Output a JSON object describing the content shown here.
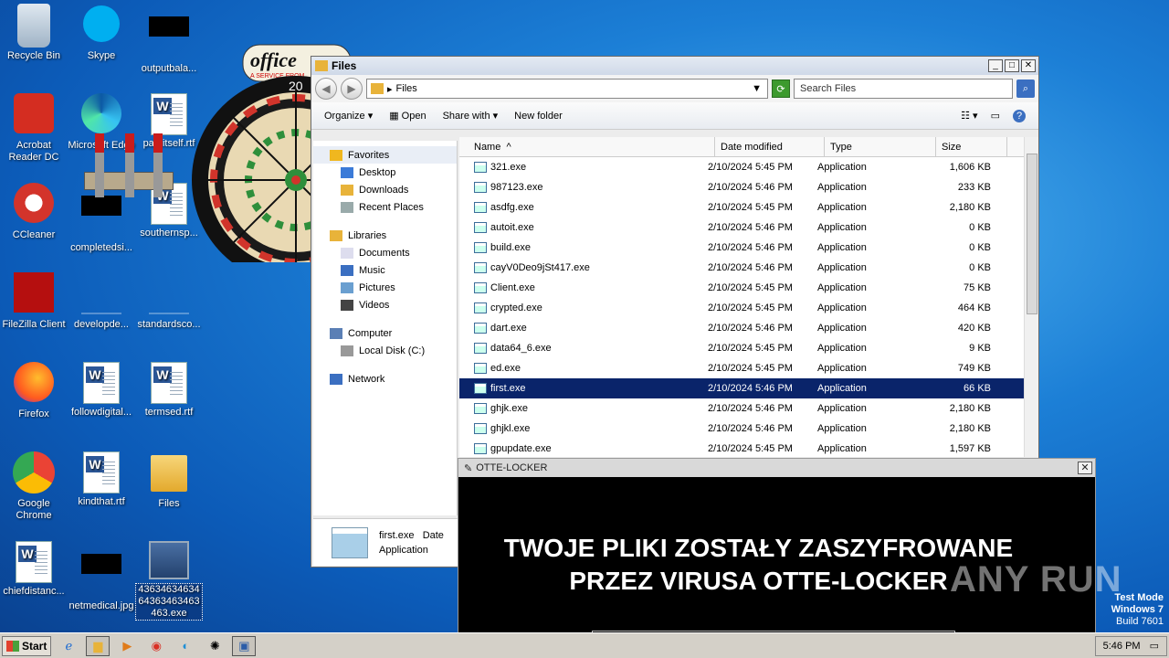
{
  "desktop": {
    "icons": [
      {
        "label": "Recycle Bin",
        "kind": "recycle"
      },
      {
        "label": "Skype",
        "kind": "skype"
      },
      {
        "label": "outputbala...",
        "kind": "black"
      },
      {
        "label": "Acrobat Reader DC",
        "kind": "acrobat"
      },
      {
        "label": "Microsoft Edge",
        "kind": "edge"
      },
      {
        "label": "pathitself.rtf",
        "kind": "word"
      },
      {
        "label": "CCleaner",
        "kind": "ccleaner"
      },
      {
        "label": "completedsi...",
        "kind": "black"
      },
      {
        "label": "southernsp...",
        "kind": "word"
      },
      {
        "label": "FileZilla Client",
        "kind": "filezilla"
      },
      {
        "label": "developde...",
        "kind": "blank"
      },
      {
        "label": "standardsco...",
        "kind": "blank"
      },
      {
        "label": "Firefox",
        "kind": "firefox"
      },
      {
        "label": "followdigital...",
        "kind": "word"
      },
      {
        "label": "termsed.rtf",
        "kind": "word"
      },
      {
        "label": "Google Chrome",
        "kind": "chrome"
      },
      {
        "label": "kindthat.rtf",
        "kind": "word"
      },
      {
        "label": "Files",
        "kind": "folder"
      },
      {
        "label": "chiefdistanc...",
        "kind": "word"
      },
      {
        "label": "netmedical.jpg",
        "kind": "black"
      },
      {
        "label": "43634634634 64363463463 463.exe",
        "kind": "exe"
      }
    ]
  },
  "dart": {
    "brand": "office",
    "tagline": "A SERVICE FROM"
  },
  "explorer": {
    "title": "Files",
    "address": "Files",
    "search_placeholder": "Search Files",
    "toolbar": {
      "organize": "Organize",
      "open": "Open",
      "share": "Share with",
      "new_folder": "New folder"
    },
    "nav": [
      {
        "label": "Favorites",
        "group": true
      },
      {
        "label": "Desktop"
      },
      {
        "label": "Downloads"
      },
      {
        "label": "Recent Places"
      },
      {
        "label": "Libraries",
        "group": true
      },
      {
        "label": "Documents"
      },
      {
        "label": "Music"
      },
      {
        "label": "Pictures"
      },
      {
        "label": "Videos"
      },
      {
        "label": "Computer",
        "group": true
      },
      {
        "label": "Local Disk (C:)"
      },
      {
        "label": "Network",
        "group": true
      }
    ],
    "columns": {
      "name": "Name",
      "date": "Date modified",
      "type": "Type",
      "size": "Size"
    },
    "files": [
      {
        "name": "321.exe",
        "date": "2/10/2024 5:45 PM",
        "type": "Application",
        "size": "1,606 KB"
      },
      {
        "name": "987123.exe",
        "date": "2/10/2024 5:46 PM",
        "type": "Application",
        "size": "233 KB"
      },
      {
        "name": "asdfg.exe",
        "date": "2/10/2024 5:45 PM",
        "type": "Application",
        "size": "2,180 KB"
      },
      {
        "name": "autoit.exe",
        "date": "2/10/2024 5:46 PM",
        "type": "Application",
        "size": "0 KB"
      },
      {
        "name": "build.exe",
        "date": "2/10/2024 5:46 PM",
        "type": "Application",
        "size": "0 KB"
      },
      {
        "name": "cayV0Deo9jSt417.exe",
        "date": "2/10/2024 5:46 PM",
        "type": "Application",
        "size": "0 KB"
      },
      {
        "name": "Client.exe",
        "date": "2/10/2024 5:45 PM",
        "type": "Application",
        "size": "75 KB"
      },
      {
        "name": "crypted.exe",
        "date": "2/10/2024 5:45 PM",
        "type": "Application",
        "size": "464 KB"
      },
      {
        "name": "dart.exe",
        "date": "2/10/2024 5:46 PM",
        "type": "Application",
        "size": "420 KB"
      },
      {
        "name": "data64_6.exe",
        "date": "2/10/2024 5:45 PM",
        "type": "Application",
        "size": "9 KB"
      },
      {
        "name": "ed.exe",
        "date": "2/10/2024 5:45 PM",
        "type": "Application",
        "size": "749 KB"
      },
      {
        "name": "first.exe",
        "date": "2/10/2024 5:46 PM",
        "type": "Application",
        "size": "66 KB",
        "selected": true
      },
      {
        "name": "ghjk.exe",
        "date": "2/10/2024 5:46 PM",
        "type": "Application",
        "size": "2,180 KB"
      },
      {
        "name": "ghjkl.exe",
        "date": "2/10/2024 5:46 PM",
        "type": "Application",
        "size": "2,180 KB"
      },
      {
        "name": "gpupdate.exe",
        "date": "2/10/2024 5:45 PM",
        "type": "Application",
        "size": "1,597 KB"
      }
    ],
    "details": {
      "name": "first.exe",
      "label": "Date",
      "type": "Application"
    }
  },
  "locker": {
    "title": "OTTE-LOCKER",
    "line1": "TWOJE PLIKI ZOSTAŁY ZASZYFROWANE",
    "line2": "PRZEZ VIRUSA OTTE-LOCKER"
  },
  "watermark": "ANY RUN",
  "testmode": {
    "line1": "Test Mode",
    "line2": "Windows 7",
    "line3": "Build 7601"
  },
  "taskbar": {
    "start": "Start",
    "time": "5:46 PM"
  }
}
